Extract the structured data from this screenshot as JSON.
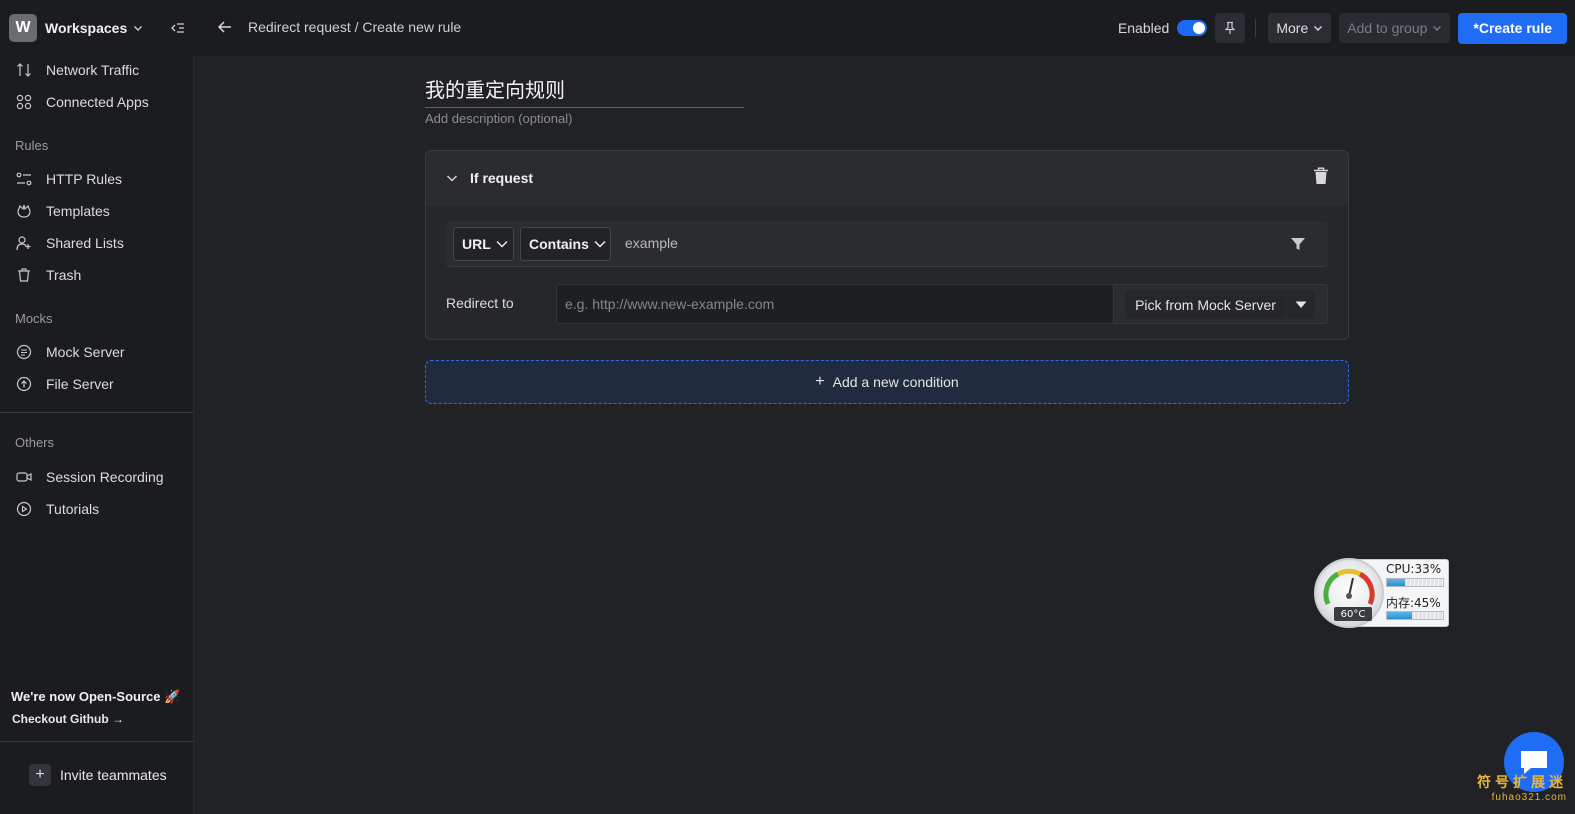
{
  "workspace": {
    "initial": "W",
    "name": "Workspaces"
  },
  "header": {
    "breadcrumb": "Redirect request / Create new rule",
    "enabled_label": "Enabled",
    "more_label": "More",
    "add_group_label": "Add to group",
    "create_label": "*Create rule"
  },
  "sidebar": {
    "top_items": [
      {
        "label": "Network Traffic",
        "icon": "arrows-updown-icon"
      },
      {
        "label": "Connected Apps",
        "icon": "grid-icon"
      }
    ],
    "rules_title": "Rules",
    "rules_items": [
      {
        "label": "HTTP Rules",
        "icon": "rules-icon"
      },
      {
        "label": "Templates",
        "icon": "template-icon"
      },
      {
        "label": "Shared Lists",
        "icon": "user-plus-icon"
      },
      {
        "label": "Trash",
        "icon": "trash-icon"
      }
    ],
    "mocks_title": "Mocks",
    "mocks_items": [
      {
        "label": "Mock Server",
        "icon": "mock-server-icon"
      },
      {
        "label": "File Server",
        "icon": "file-server-icon"
      }
    ],
    "others_title": "Others",
    "others_items": [
      {
        "label": "Session Recording",
        "icon": "video-icon"
      },
      {
        "label": "Tutorials",
        "icon": "play-circle-icon"
      }
    ],
    "promo_title": "We're now Open-Source 🚀",
    "promo_link": "Checkout Github →",
    "invite_label": "Invite teammates"
  },
  "rule": {
    "name": "我的重定向规则",
    "description_placeholder": "Add description (optional)",
    "if_request_label": "If request",
    "source_key": "URL",
    "operator": "Contains",
    "source_value": "example",
    "redirect_label": "Redirect to",
    "redirect_placeholder": "e.g. http://www.new-example.com",
    "pick_mock_label": "Pick from Mock Server",
    "add_condition_label": "Add a new condition"
  },
  "widget": {
    "cpu_label": "CPU:33%",
    "cpu_fraction": 0.33,
    "mem_label": "内存:45%",
    "mem_fraction": 0.45,
    "temp_label": "60°C"
  },
  "watermark": {
    "line1": "符号扩展迷",
    "line2": "fuhao321.com"
  },
  "colors": {
    "accent": "#1f6cf5",
    "background": "#212226",
    "sidebar": "#1b1c20"
  }
}
